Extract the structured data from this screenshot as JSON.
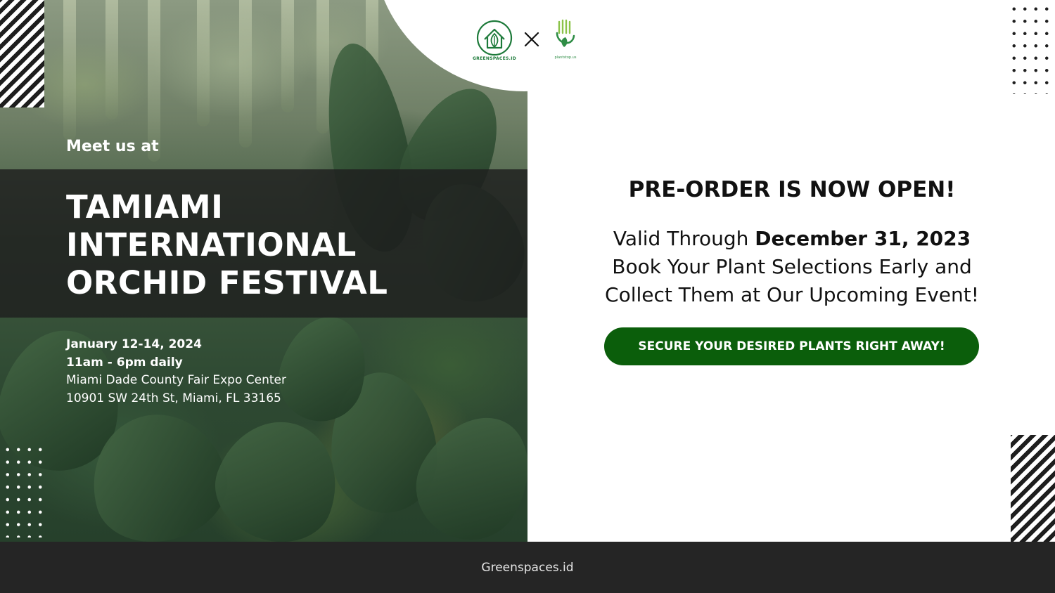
{
  "banner": {
    "intro": "Meet us at",
    "event_title_lines": [
      "TAMIAMI",
      "INTERNATIONAL",
      "ORCHID FESTIVAL"
    ],
    "dates": "January 12-14, 2024",
    "hours": "11am - 6pm daily",
    "venue": "Miami Dade County Fair Expo Center",
    "address": "10901 SW 24th St, Miami, FL 33165"
  },
  "logos": {
    "greenspaces_text": "GREENSPACES.ID",
    "separator_icon": "close-icon",
    "plantstop_text": "plantstop.us"
  },
  "promo": {
    "heading": "PRE-ORDER IS NOW OPEN!",
    "valid_prefix": "Valid Through ",
    "valid_date": "December 31, 2023",
    "line2": "Book Your Plant Selections Early and",
    "line3": "Collect Them at Our Upcoming Event!",
    "cta_label": "SECURE YOUR DESIRED PLANTS RIGHT AWAY!"
  },
  "footer": {
    "site": "Greenspaces.id"
  },
  "colors": {
    "cta_background": "#0b5e0b",
    "footer_background": "#252525",
    "brand_green": "#1d7a3a"
  }
}
